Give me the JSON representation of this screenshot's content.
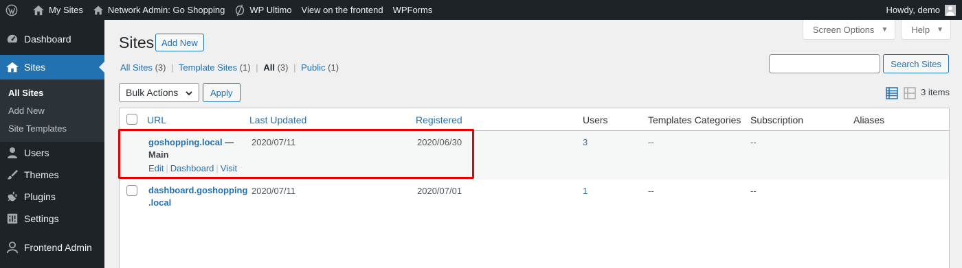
{
  "adminbar": {
    "my_sites": "My Sites",
    "network_admin": "Network Admin: Go Shopping",
    "wp_ultimo": "WP Ultimo",
    "view_frontend": "View on the frontend",
    "wpforms": "WPForms",
    "howdy": "Howdy, demo"
  },
  "sidebar": {
    "dashboard": "Dashboard",
    "sites": "Sites",
    "sub_all_sites": "All Sites",
    "sub_add_new": "Add New",
    "sub_site_templates": "Site Templates",
    "users": "Users",
    "themes": "Themes",
    "plugins": "Plugins",
    "settings": "Settings",
    "frontend_admin": "Frontend Admin"
  },
  "screen_meta": {
    "screen_options": "Screen Options",
    "help": "Help"
  },
  "page": {
    "title": "Sites",
    "add_new": "Add New"
  },
  "filters": {
    "all_sites": "All Sites",
    "all_sites_count": "(3)",
    "template_sites": "Template Sites",
    "template_sites_count": "(1)",
    "all": "All",
    "all_count": "(3)",
    "public": "Public",
    "public_count": "(1)"
  },
  "search": {
    "value": "",
    "button": "Search Sites"
  },
  "bulk": {
    "selected": "Bulk Actions",
    "apply": "Apply"
  },
  "items_count": "3 items",
  "table": {
    "columns": {
      "url": "URL",
      "last_updated": "Last Updated",
      "registered": "Registered",
      "users": "Users",
      "templates_categories": "Templates Categories",
      "subscription": "Subscription",
      "aliases": "Aliases"
    },
    "rows": [
      {
        "url_line1": "goshopping.local",
        "state": "— Main",
        "last_updated": "2020/07/11",
        "registered": "2020/06/30",
        "users": "3",
        "templates_categories": "--",
        "subscription": "--",
        "aliases": "",
        "actions": {
          "edit": "Edit",
          "dashboard": "Dashboard",
          "visit": "Visit"
        }
      },
      {
        "url_line1": "dashboard.goshopping",
        "url_line2": ".local",
        "last_updated": "2020/07/11",
        "registered": "2020/07/01",
        "users": "1",
        "templates_categories": "--",
        "subscription": "--",
        "aliases": ""
      }
    ]
  },
  "colors": {
    "admin_dark": "#1d2327",
    "accent": "#2271b1",
    "highlight": "#e60000"
  }
}
